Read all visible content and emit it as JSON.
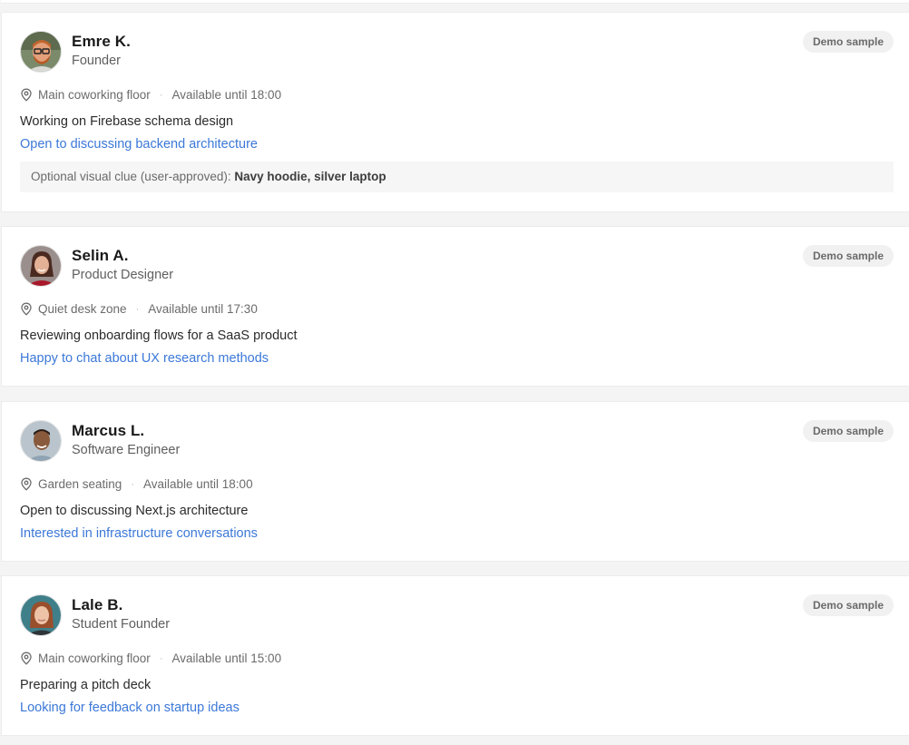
{
  "cards": [
    {
      "name": "Emre K.",
      "role": "Founder",
      "badge": "Demo sample",
      "location": "Main coworking floor",
      "availability": "Available until 18:00",
      "activity": "Working on Firebase schema design",
      "openness": "Open to discussing backend architecture",
      "clue_label": "Optional visual clue (user-approved):",
      "clue_value": "Navy hoodie, silver laptop"
    },
    {
      "name": "Selin A.",
      "role": "Product Designer",
      "badge": "Demo sample",
      "location": "Quiet desk zone",
      "availability": "Available until 17:30",
      "activity": "Reviewing onboarding flows for a SaaS product",
      "openness": "Happy to chat about UX research methods"
    },
    {
      "name": "Marcus L.",
      "role": "Software Engineer",
      "badge": "Demo sample",
      "location": "Garden seating",
      "availability": "Available until 18:00",
      "activity": "Open to discussing Next.js architecture",
      "openness": "Interested in infrastructure conversations"
    },
    {
      "name": "Lale B.",
      "role": "Student Founder",
      "badge": "Demo sample",
      "location": "Main coworking floor",
      "availability": "Available until 15:00",
      "activity": "Preparing a pitch deck",
      "openness": "Looking for feedback on startup ideas"
    }
  ],
  "separator": "·",
  "colors": {
    "page_background": "#f4f4f4",
    "card_background": "#ffffff",
    "link_blue": "#3b78d8",
    "badge_background": "#f1f1f1"
  },
  "icons": {
    "location": "map-pin-icon"
  }
}
